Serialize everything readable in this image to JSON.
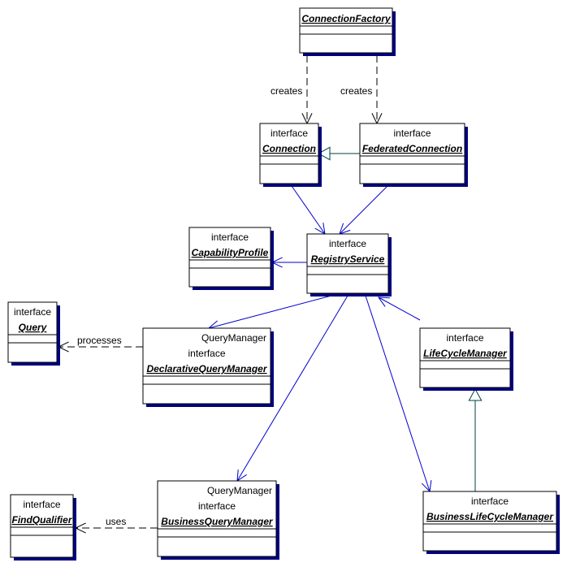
{
  "diagram": {
    "type": "uml-class-diagram",
    "classes": [
      {
        "id": "ConnectionFactory",
        "stereotypes": [],
        "name": "ConnectionFactory"
      },
      {
        "id": "Connection",
        "stereotypes": [
          "interface"
        ],
        "name": "Connection"
      },
      {
        "id": "FederatedConnection",
        "stereotypes": [
          "interface"
        ],
        "name": "FederatedConnection"
      },
      {
        "id": "CapabilityProfile",
        "stereotypes": [
          "interface"
        ],
        "name": "CapabilityProfile"
      },
      {
        "id": "RegistryService",
        "stereotypes": [
          "interface"
        ],
        "name": "RegistryService"
      },
      {
        "id": "Query",
        "stereotypes": [
          "interface"
        ],
        "name": "Query"
      },
      {
        "id": "DeclarativeQueryManager",
        "stereotypes": [
          "QueryManager",
          "interface"
        ],
        "name": "DeclarativeQueryManager"
      },
      {
        "id": "LifeCycleManager",
        "stereotypes": [
          "interface"
        ],
        "name": "LifeCycleManager"
      },
      {
        "id": "FindQualifier",
        "stereotypes": [
          "interface"
        ],
        "name": "FindQualifier"
      },
      {
        "id": "BusinessQueryManager",
        "stereotypes": [
          "QueryManager",
          "interface"
        ],
        "name": "BusinessQueryManager"
      },
      {
        "id": "BusinessLifeCycleManager",
        "stereotypes": [
          "interface"
        ],
        "name": "BusinessLifeCycleManager"
      }
    ],
    "relationships": [
      {
        "kind": "dependency",
        "from": "ConnectionFactory",
        "to": "Connection",
        "label": "creates"
      },
      {
        "kind": "dependency",
        "from": "ConnectionFactory",
        "to": "FederatedConnection",
        "label": "creates"
      },
      {
        "kind": "generalization",
        "from": "FederatedConnection",
        "to": "Connection",
        "label": ""
      },
      {
        "kind": "association",
        "from": "Connection",
        "to": "RegistryService",
        "label": ""
      },
      {
        "kind": "association",
        "from": "FederatedConnection",
        "to": "RegistryService",
        "label": ""
      },
      {
        "kind": "association",
        "from": "RegistryService",
        "to": "CapabilityProfile",
        "label": ""
      },
      {
        "kind": "association",
        "from": "RegistryService",
        "to": "DeclarativeQueryManager",
        "label": ""
      },
      {
        "kind": "association",
        "from": "RegistryService",
        "to": "BusinessQueryManager",
        "label": ""
      },
      {
        "kind": "association",
        "from": "RegistryService",
        "to": "BusinessLifeCycleManager",
        "label": ""
      },
      {
        "kind": "association",
        "from": "LifeCycleManager",
        "to": "RegistryService",
        "label": ""
      },
      {
        "kind": "generalization",
        "from": "BusinessLifeCycleManager",
        "to": "LifeCycleManager",
        "label": ""
      },
      {
        "kind": "dependency",
        "from": "DeclarativeQueryManager",
        "to": "Query",
        "label": "processes"
      },
      {
        "kind": "dependency",
        "from": "BusinessQueryManager",
        "to": "FindQualifier",
        "label": "uses"
      }
    ]
  }
}
